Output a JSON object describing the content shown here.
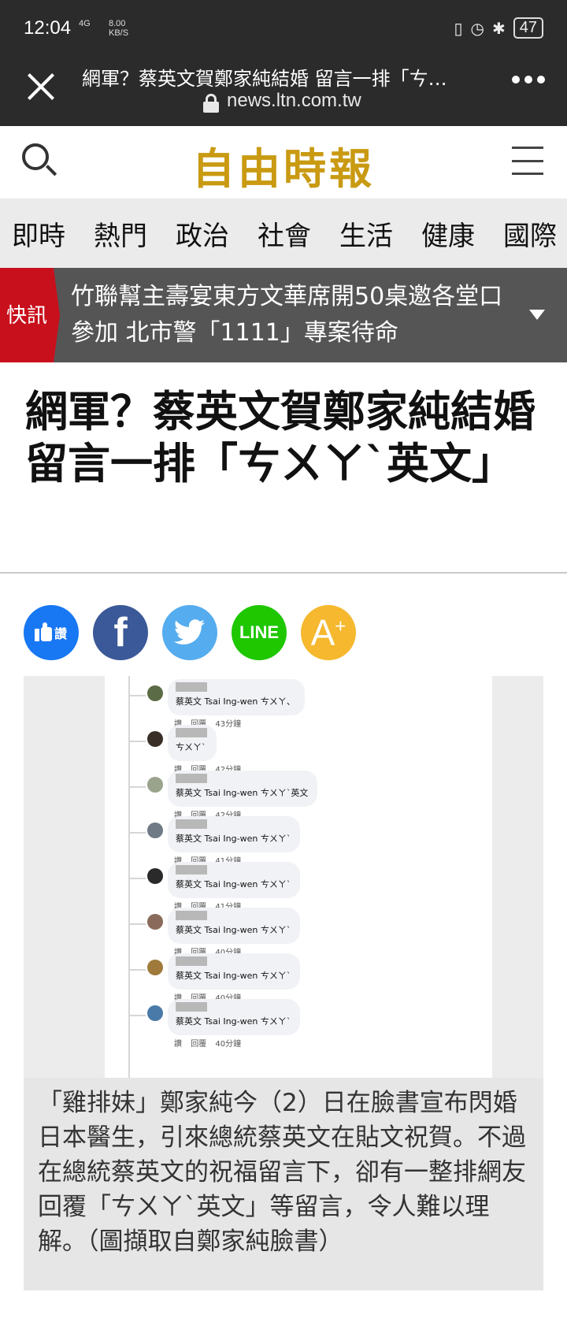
{
  "status_bar": {
    "time": "12:04",
    "network": "4G",
    "speed_value": "8.00",
    "speed_unit": "KB/S",
    "battery": "47"
  },
  "browser": {
    "title": "網軍？蔡英文賀鄭家純結婚 留言一排「ㄘ…",
    "url": "news.ltn.com.tw"
  },
  "site": {
    "logo": "自由時報"
  },
  "nav": {
    "categories": [
      "即時",
      "熱門",
      "政治",
      "社會",
      "生活",
      "健康",
      "國際"
    ]
  },
  "breaking": {
    "tag": "快訊",
    "text": "竹聯幫主壽宴東方文華席開50桌邀各堂口參加 北市警「1111」專案待命"
  },
  "article": {
    "headline": "網軍？蔡英文賀鄭家純結婚 留言一排「ㄘㄨㄚˋ英文」",
    "caption": "「雞排妹」鄭家純今（2）日在臉書宣布閃婚日本醫生，引來總統蔡英文在貼文祝賀。不過在總統蔡英文的祝福留言下，卻有一整排網友回覆「ㄘㄨㄚˋ英文」等留言，令人難以理解。（圖擷取自鄭家純臉書）"
  },
  "share": {
    "like_label": "讚",
    "facebook_label": "f",
    "line_label": "LINE",
    "font_label": "A",
    "font_sup": "+",
    "colors": {
      "like": "#1877f2",
      "facebook": "#3b5998",
      "twitter": "#55acee",
      "line": "#1ec700",
      "font": "#f5b82e"
    }
  },
  "comments": {
    "reply_label": "回覆",
    "like_label": "讚",
    "items": [
      {
        "text": "蔡英文 Tsai Ing-wen ㄘㄨㄚ、",
        "time": "43分鐘",
        "avatar_color": "#5b6b45"
      },
      {
        "text": "ㄘㄨㄚˋ",
        "time": "42分鐘",
        "avatar_color": "#3a2f28"
      },
      {
        "text": "蔡英文 Tsai Ing-wen ㄘㄨㄚˋ英文",
        "time": "42分鐘",
        "avatar_color": "#9aa38c"
      },
      {
        "text": "蔡英文 Tsai Ing-wen ㄘㄨㄚˋ",
        "time": "41分鐘",
        "avatar_color": "#6f7a86"
      },
      {
        "text": "蔡英文 Tsai Ing-wen ㄘㄨㄚˋ",
        "time": "41分鐘",
        "avatar_color": "#2a2a2a"
      },
      {
        "text": "蔡英文 Tsai Ing-wen ㄘㄨㄚˋ",
        "time": "40分鐘",
        "avatar_color": "#8a6a5a"
      },
      {
        "text": "蔡英文 Tsai Ing-wen ㄘㄨㄚˋ",
        "time": "40分鐘",
        "avatar_color": "#a07a3a"
      },
      {
        "text": "蔡英文 Tsai Ing-wen ㄘㄨㄚˋ",
        "time": "40分鐘",
        "avatar_color": "#4a7aa8"
      }
    ]
  }
}
